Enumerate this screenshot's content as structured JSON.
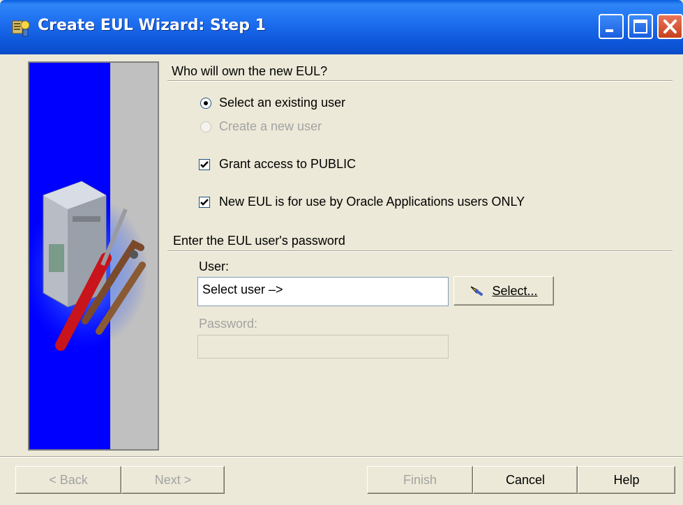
{
  "window": {
    "title": "Create EUL Wizard: Step 1"
  },
  "owner": {
    "heading": "Who will own the new EUL?",
    "option_existing": "Select an existing user",
    "option_new": "Create a new user",
    "grant_public": "Grant access to PUBLIC",
    "oracle_apps_only": "New EUL is for use by Oracle Applications users ONLY"
  },
  "password_section": {
    "heading": "Enter the EUL user's password",
    "user_label": "User:",
    "user_value": "Select user –>",
    "select_button": "Select...",
    "password_label": "Password:",
    "password_value": ""
  },
  "buttons": {
    "back": "< Back",
    "next": "Next >",
    "finish": "Finish",
    "cancel": "Cancel",
    "help": "Help"
  },
  "colors": {
    "title_bar": "#0a5ee0",
    "art_blue": "#0000ff",
    "dialog_bg": "#ece9d8",
    "disabled_text": "#a3a3a3"
  }
}
